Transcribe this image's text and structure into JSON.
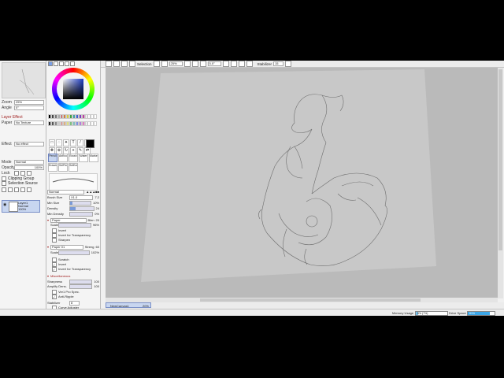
{
  "navigator": {
    "zoom_label": "Zoom",
    "zoom_value": "25%",
    "angle_label": "Angle",
    "angle_value": "0°"
  },
  "layer_effect": {
    "header": "Layer Effect",
    "paper_label": "Paper",
    "paper_value": "No Texture",
    "effect_label": "Effect",
    "effect_value": "No effect"
  },
  "layer_props": {
    "mode_label": "Mode",
    "mode_value": "Normal",
    "opacity_label": "Opacity",
    "opacity_value": "100%",
    "lock_label": "Lock",
    "clipping_label": "Clipping Group",
    "selection_source_label": "Selection Source"
  },
  "layers": [
    {
      "name": "Layer1",
      "mode": "Normal",
      "opacity": "100%"
    }
  ],
  "brush_tools": [
    {
      "label": "Pencil",
      "selected": true
    },
    {
      "label": "AirBrush",
      "selected": false
    },
    {
      "label": "Brush",
      "selected": false
    },
    {
      "label": "Water",
      "selected": false
    },
    {
      "label": "Marker",
      "selected": false
    },
    {
      "label": "Eraser",
      "selected": false
    },
    {
      "label": "SelPen",
      "selected": false
    },
    {
      "label": "SelEra",
      "selected": false
    }
  ],
  "brush_settings": {
    "blend_value": "Normal",
    "brush_size_label": "Brush Size",
    "brush_size_value": "X1.0",
    "brush_size_num": "7.2",
    "min_size_label": "Min Size",
    "min_size_value": "10%",
    "min_size_level": 0.1,
    "density_label": "Density",
    "density_value": "24",
    "density_level": 0.24,
    "min_density_label": "Min Density",
    "min_density_value": "0%",
    "paper_label": "Paper",
    "paper_value": "Blen",
    "paper_num": "20",
    "scale_label": "Scale",
    "scale_value": "96%",
    "invert_label": "Invert",
    "invert_transparency_label": "Invert for Transparency",
    "sharpen_label": "Sharpen",
    "paper01_label": "Paper 01",
    "paper01_value": "Streng",
    "paper01_num": "60",
    "scale2_value": "102%",
    "scratch_label": "Scratch",
    "invert2_label": "Invert",
    "invert_transparency2_label": "Invert for Transparency",
    "misc_header": "Miscellaneous",
    "sharpness_label": "Sharpness",
    "sharpness_value": "100",
    "amplify_label": "Amplify Dens.",
    "amplify_value": "100",
    "ver1_label": "Ver1 Pro Spec.",
    "antiripple_label": "Anti-Ripple",
    "stabilizer_label": "Stabilizer",
    "stabilizer_value": "8",
    "curve_label": "Curve Adjuster"
  },
  "toolbar": {
    "selection_label": "Selection",
    "zoom_value": "25%",
    "angle_value": "5.0°",
    "stabilizer_label": "Stabilizer",
    "stabilizer_value": "15"
  },
  "tabs": [
    {
      "label": "NewCanvas1",
      "zoom": "20%"
    }
  ],
  "status": {
    "memory_label": "Memory Usage",
    "memory_value": "8% (7%)",
    "memory_level": 0.08,
    "drive_label": "Drive Space",
    "drive_value": "81%",
    "drive_level": 0.81
  },
  "colors": {
    "accent": "#c8d6f0",
    "canvas_bg": "#bababa",
    "paper": "#c9c9c9"
  }
}
